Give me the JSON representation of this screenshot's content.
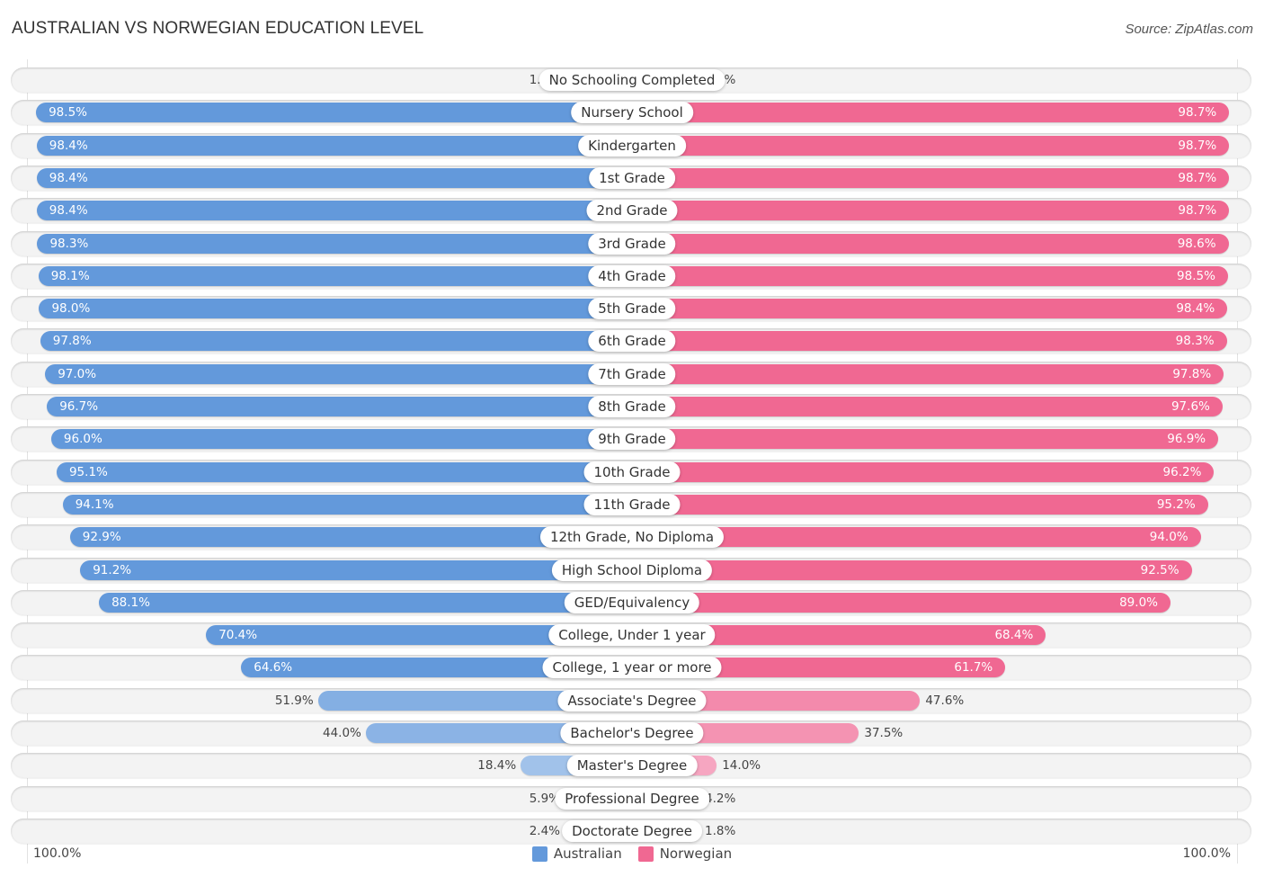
{
  "header": {
    "title": "AUSTRALIAN VS NORWEGIAN EDUCATION LEVEL",
    "source": "Source: ZipAtlas.com"
  },
  "colors": {
    "australian_strong": "#6399db",
    "australian_light": "#a8c7ec",
    "norwegian_strong": "#f06892",
    "norwegian_light": "#f6a9c3"
  },
  "axis": {
    "left_label": "100.0%",
    "right_label": "100.0%"
  },
  "legend": [
    {
      "name": "Australian",
      "color": "#6399db"
    },
    {
      "name": "Norwegian",
      "color": "#f06892"
    }
  ],
  "chart_data": {
    "type": "bar",
    "orientation": "horizontal-diverging",
    "title": "AUSTRALIAN VS NORWEGIAN EDUCATION LEVEL",
    "xlabel": "",
    "ylabel": "",
    "xlim": [
      0,
      100
    ],
    "legend_position": "bottom-center",
    "categories": [
      "No Schooling Completed",
      "Nursery School",
      "Kindergarten",
      "1st Grade",
      "2nd Grade",
      "3rd Grade",
      "4th Grade",
      "5th Grade",
      "6th Grade",
      "7th Grade",
      "8th Grade",
      "9th Grade",
      "10th Grade",
      "11th Grade",
      "12th Grade, No Diploma",
      "High School Diploma",
      "GED/Equivalency",
      "College, Under 1 year",
      "College, 1 year or more",
      "Associate's Degree",
      "Bachelor's Degree",
      "Master's Degree",
      "Professional Degree",
      "Doctorate Degree"
    ],
    "series": [
      {
        "name": "Australian",
        "side": "left",
        "values": [
          1.6,
          98.5,
          98.4,
          98.4,
          98.4,
          98.3,
          98.1,
          98.0,
          97.8,
          97.0,
          96.7,
          96.0,
          95.1,
          94.1,
          92.9,
          91.2,
          88.1,
          70.4,
          64.6,
          51.9,
          44.0,
          18.4,
          5.9,
          2.4
        ],
        "labels": [
          "1.6%",
          "98.5%",
          "98.4%",
          "98.4%",
          "98.4%",
          "98.3%",
          "98.1%",
          "98.0%",
          "97.8%",
          "97.0%",
          "96.7%",
          "96.0%",
          "95.1%",
          "94.1%",
          "92.9%",
          "91.2%",
          "88.1%",
          "70.4%",
          "64.6%",
          "51.9%",
          "44.0%",
          "18.4%",
          "5.9%",
          "2.4%"
        ]
      },
      {
        "name": "Norwegian",
        "side": "right",
        "values": [
          1.3,
          98.7,
          98.7,
          98.7,
          98.7,
          98.6,
          98.5,
          98.4,
          98.3,
          97.8,
          97.6,
          96.9,
          96.2,
          95.2,
          94.0,
          92.5,
          89.0,
          68.4,
          61.7,
          47.6,
          37.5,
          14.0,
          4.2,
          1.8
        ],
        "labels": [
          "1.3%",
          "98.7%",
          "98.7%",
          "98.7%",
          "98.7%",
          "98.6%",
          "98.5%",
          "98.4%",
          "98.3%",
          "97.8%",
          "97.6%",
          "96.9%",
          "96.2%",
          "95.2%",
          "94.0%",
          "92.5%",
          "89.0%",
          "68.4%",
          "61.7%",
          "47.6%",
          "37.5%",
          "14.0%",
          "4.2%",
          "1.8%"
        ]
      }
    ]
  }
}
